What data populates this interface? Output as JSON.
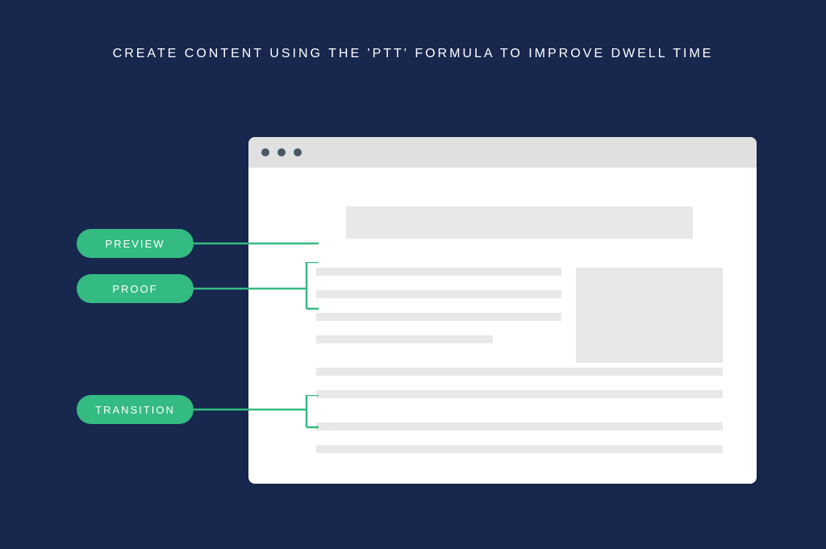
{
  "title": "CREATE CONTENT USING THE 'PTT' FORMULA TO IMPROVE DWELL TIME",
  "labels": {
    "preview": "PREVIEW",
    "proof": "PROOF",
    "transition": "TRANSITION"
  },
  "colors": {
    "background": "#17274e",
    "accent": "#34bb82",
    "browser_bar": "#e0e0e0",
    "placeholder": "#e8e8e8"
  }
}
